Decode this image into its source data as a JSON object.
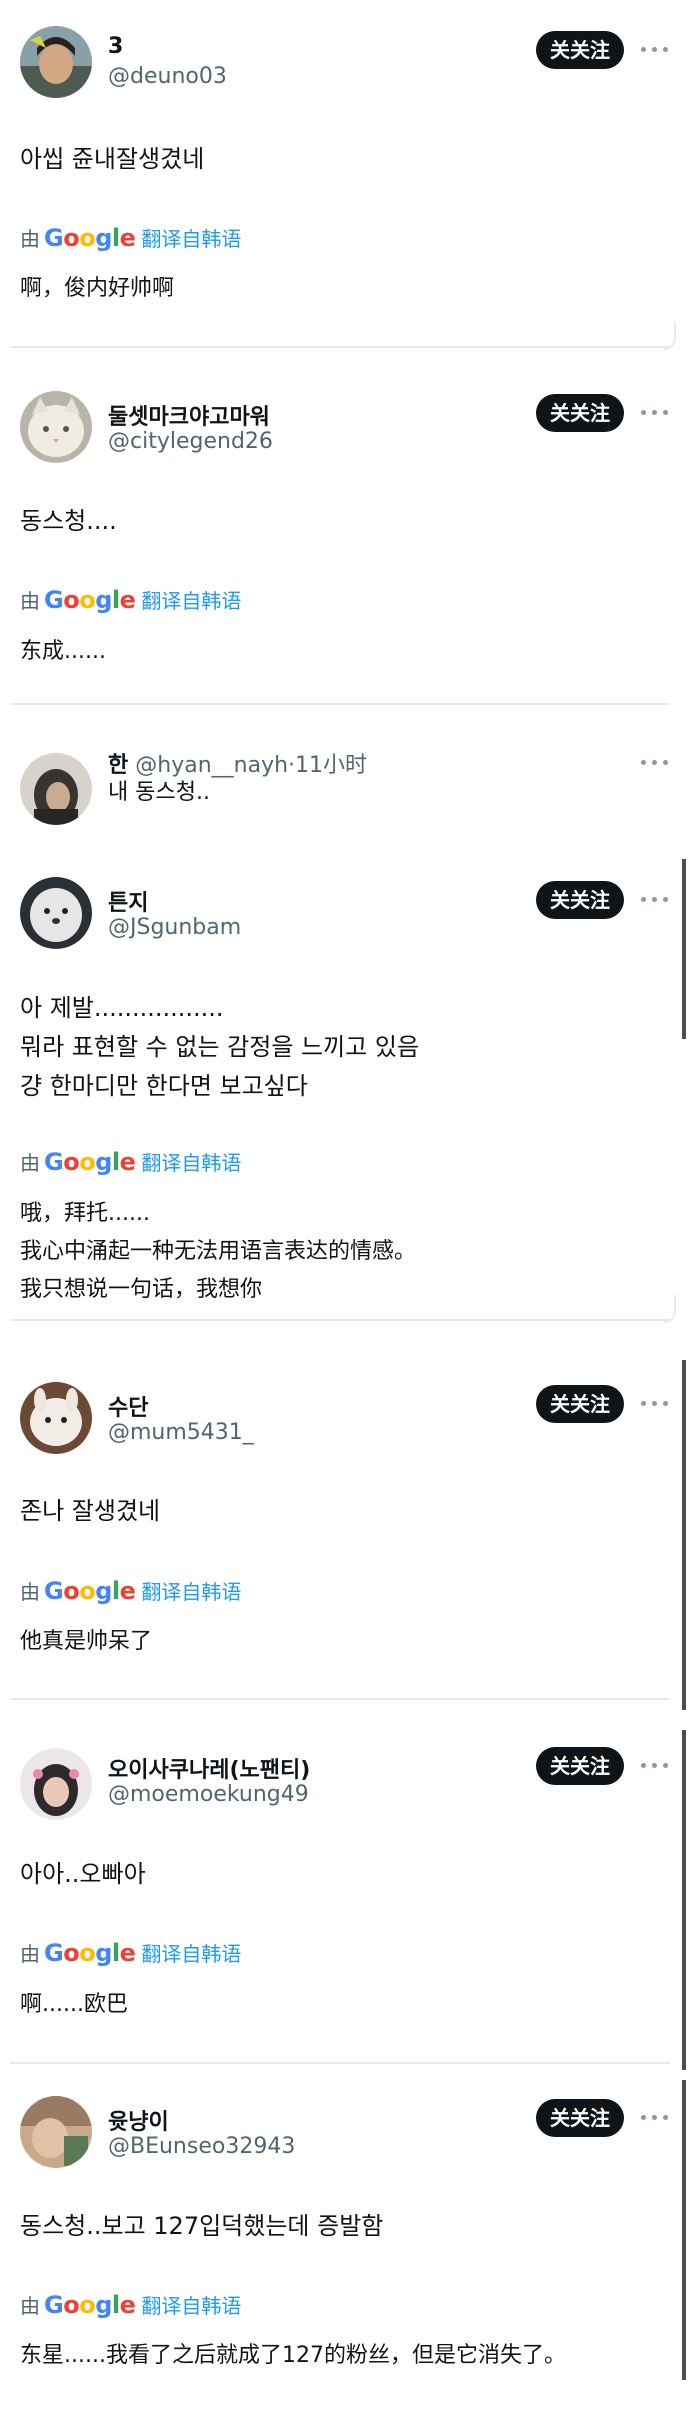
{
  "follow_label": "关关注",
  "translate": {
    "prefix": "由",
    "brand": [
      "G",
      "o",
      "o",
      "g",
      "l",
      "e"
    ],
    "brand_colors": [
      "#4285f4",
      "#ea4335",
      "#fbbc05",
      "#4285f4",
      "#34a853",
      "#ea4335"
    ],
    "label": "翻译自韩语"
  },
  "posts": [
    {
      "display_name": "3",
      "handle": "@deuno03",
      "text": "아씹 쥰내잘생겼네",
      "translation": "啊，俊内好帅啊"
    },
    {
      "display_name": "둘셋마크야고마워",
      "handle": "@citylegend26",
      "text": "동스청....",
      "translation": "东成......"
    },
    {
      "display_name": "튼지",
      "handle": "@JSgunbam",
      "text": "아 제발.................\n뭐라 표현할 수 없는 감정을 느끼고 있음\n걍 한마디만 한다면 보고싶다",
      "translation": "哦，拜托......\n我心中涌起一种无法用语言表达的情感。\n我只想说一句话，我想你"
    },
    {
      "display_name": "수단",
      "handle": "@mum5431_",
      "text": "존나 잘생겼네",
      "translation": "他真是帅呆了"
    },
    {
      "display_name": "오이사쿠나레(노팬티)",
      "handle": "@moemoekung49",
      "text": "아아..오빠아",
      "translation": "啊......欧巴"
    },
    {
      "display_name": "윳냥이",
      "handle": "@BEunseo32943",
      "text": "동스청..보고 127입덕했는데 증발함",
      "translation": "东星......我看了之后就成了127的粉丝，但是它消失了。"
    }
  ],
  "reply": {
    "display_name": "한",
    "handle": "@hyan__nayh",
    "separator": "·",
    "time": "11小时",
    "text": "내 동스청.."
  }
}
